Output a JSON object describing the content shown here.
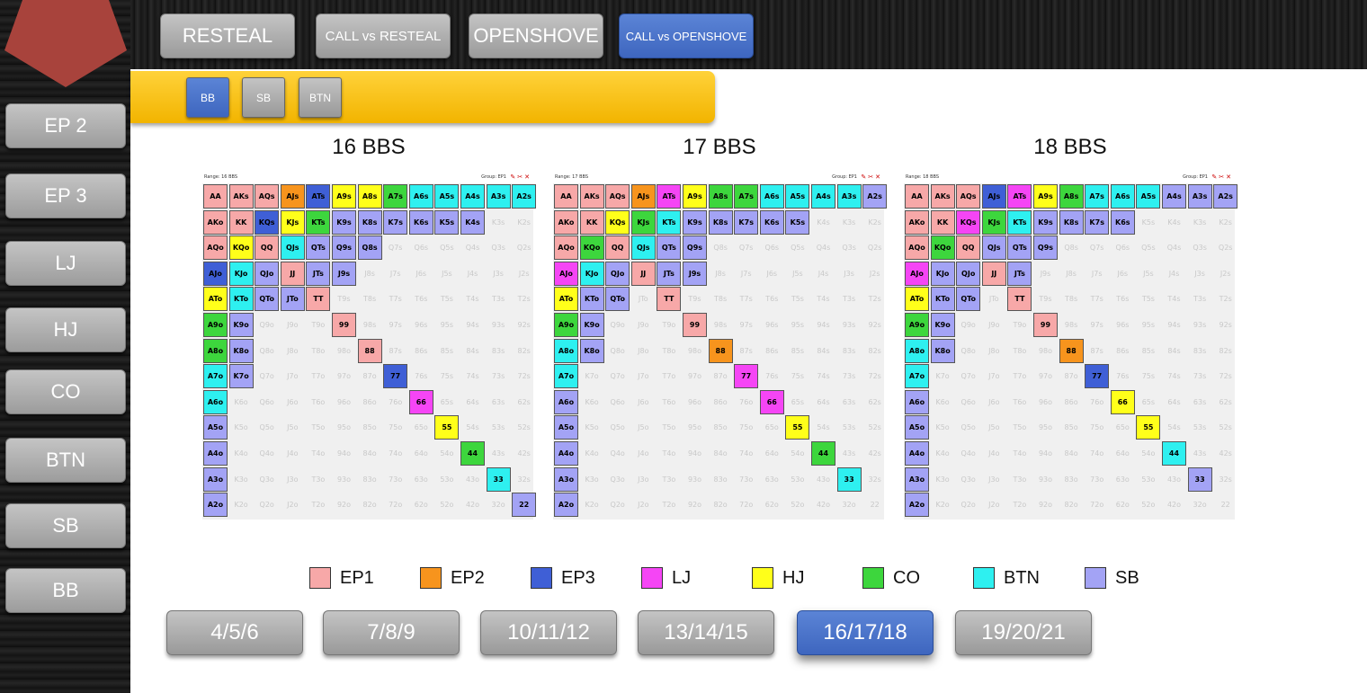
{
  "top_tabs": [
    {
      "label": "RESTEAL",
      "active": false
    },
    {
      "label": "CALL vs RESTEAL",
      "active": false
    },
    {
      "label": "OPENSHOVE",
      "active": false
    },
    {
      "label": "CALL vs OPENSHOVE",
      "active": true
    }
  ],
  "sidebar": {
    "items": [
      {
        "label": "EP 2"
      },
      {
        "label": "EP 3"
      },
      {
        "label": "LJ"
      },
      {
        "label": "HJ"
      },
      {
        "label": "CO"
      },
      {
        "label": "BTN"
      },
      {
        "label": "SB"
      },
      {
        "label": "BB"
      }
    ]
  },
  "position_tabs": [
    {
      "label": "BB",
      "active": true
    },
    {
      "label": "SB",
      "active": false
    },
    {
      "label": "BTN",
      "active": false
    }
  ],
  "colors": {
    "EP1": "#f7a8a8",
    "EP2": "#f7941d",
    "EP3": "#3f5fd6",
    "LJ": "#f545f5",
    "HJ": "#ffff1a",
    "CO": "#3dd63d",
    "BTN": "#2ef0f0",
    "SB": "#a3a3f5"
  },
  "legend": [
    {
      "key": "EP1",
      "label": "EP1"
    },
    {
      "key": "EP2",
      "label": "EP2"
    },
    {
      "key": "EP3",
      "label": "EP3"
    },
    {
      "key": "LJ",
      "label": "LJ"
    },
    {
      "key": "HJ",
      "label": "HJ"
    },
    {
      "key": "CO",
      "label": "CO"
    },
    {
      "key": "BTN",
      "label": "BTN"
    },
    {
      "key": "SB",
      "label": "SB"
    }
  ],
  "ranks": [
    "A",
    "K",
    "Q",
    "J",
    "T",
    "9",
    "8",
    "7",
    "6",
    "5",
    "4",
    "3",
    "2"
  ],
  "charts": [
    {
      "title": "16 BBS",
      "range_label": "Range: 16 BBS",
      "group_label": "Group: EP1",
      "cells": {
        "AA": "EP1",
        "AKs": "EP1",
        "AQs": "EP1",
        "AJs": "EP2",
        "ATs": "EP3",
        "A9s": "HJ",
        "A8s": "HJ",
        "A7s": "CO",
        "A6s": "BTN",
        "A5s": "BTN",
        "A4s": "BTN",
        "A3s": "BTN",
        "A2s": "BTN",
        "AKo": "EP1",
        "KK": "EP1",
        "KQs": "EP3",
        "KJs": "HJ",
        "KTs": "CO",
        "K9s": "SB",
        "K8s": "SB",
        "K7s": "SB",
        "K6s": "SB",
        "K5s": "SB",
        "K4s": "SB",
        "AQo": "EP1",
        "KQo": "HJ",
        "QQ": "EP1",
        "QJs": "BTN",
        "QTs": "SB",
        "Q9s": "SB",
        "Q8s": "SB",
        "AJo": "EP3",
        "KJo": "BTN",
        "QJo": "SB",
        "JJ": "EP1",
        "JTs": "SB",
        "J9s": "SB",
        "ATo": "HJ",
        "KTo": "BTN",
        "QTo": "SB",
        "JTo": "SB",
        "TT": "EP1",
        "A9o": "CO",
        "K9o": "SB",
        "99": "EP1",
        "A8o": "CO",
        "K8o": "SB",
        "88": "EP1",
        "A7o": "BTN",
        "K7o": "SB",
        "77": "EP3",
        "A6o": "BTN",
        "66": "LJ",
        "A5o": "SB",
        "55": "HJ",
        "A4o": "SB",
        "44": "CO",
        "A3o": "SB",
        "33": "BTN",
        "A2o": "SB",
        "22": "SB"
      }
    },
    {
      "title": "17 BBS",
      "range_label": "Range: 17 BBS",
      "group_label": "Group: EP1",
      "cells": {
        "AA": "EP1",
        "AKs": "EP1",
        "AQs": "EP1",
        "AJs": "EP2",
        "ATs": "LJ",
        "A9s": "HJ",
        "A8s": "CO",
        "A7s": "CO",
        "A6s": "BTN",
        "A5s": "BTN",
        "A4s": "BTN",
        "A3s": "BTN",
        "A2s": "SB",
        "AKo": "EP1",
        "KK": "EP1",
        "KQs": "HJ",
        "KJs": "CO",
        "KTs": "BTN",
        "K9s": "SB",
        "K8s": "SB",
        "K7s": "SB",
        "K6s": "SB",
        "K5s": "SB",
        "AQo": "EP1",
        "KQo": "CO",
        "QQ": "EP1",
        "QJs": "BTN",
        "QTs": "SB",
        "Q9s": "SB",
        "AJo": "LJ",
        "KJo": "BTN",
        "QJo": "SB",
        "JJ": "EP1",
        "JTs": "SB",
        "J9s": "SB",
        "ATo": "HJ",
        "KTo": "SB",
        "QTo": "SB",
        "TT": "EP1",
        "A9o": "CO",
        "K9o": "SB",
        "99": "EP1",
        "A8o": "BTN",
        "K8o": "SB",
        "88": "EP2",
        "A7o": "BTN",
        "77": "LJ",
        "A6o": "SB",
        "66": "LJ",
        "A5o": "SB",
        "55": "HJ",
        "A4o": "SB",
        "44": "CO",
        "A3o": "SB",
        "33": "BTN",
        "A2o": "SB"
      }
    },
    {
      "title": "18 BBS",
      "range_label": "Range: 18 BBS",
      "group_label": "Group: EP1",
      "cells": {
        "AA": "EP1",
        "AKs": "EP1",
        "AQs": "EP1",
        "AJs": "EP3",
        "ATs": "LJ",
        "A9s": "HJ",
        "A8s": "CO",
        "A7s": "BTN",
        "A6s": "BTN",
        "A5s": "BTN",
        "A4s": "SB",
        "A3s": "SB",
        "A2s": "SB",
        "AKo": "EP1",
        "KK": "EP1",
        "KQs": "LJ",
        "KJs": "CO",
        "KTs": "BTN",
        "K9s": "SB",
        "K8s": "SB",
        "K7s": "SB",
        "K6s": "SB",
        "AQo": "EP1",
        "KQo": "CO",
        "QQ": "EP1",
        "QJs": "SB",
        "QTs": "SB",
        "Q9s": "SB",
        "AJo": "LJ",
        "KJo": "SB",
        "QJo": "SB",
        "JJ": "EP1",
        "JTs": "SB",
        "ATo": "HJ",
        "KTo": "SB",
        "QTo": "SB",
        "TT": "EP1",
        "A9o": "CO",
        "K9o": "SB",
        "99": "EP1",
        "A8o": "BTN",
        "K8o": "SB",
        "88": "EP2",
        "A7o": "BTN",
        "77": "EP3",
        "A6o": "SB",
        "66": "HJ",
        "A5o": "SB",
        "55": "HJ",
        "A4o": "SB",
        "44": "BTN",
        "A3o": "SB",
        "33": "SB",
        "A2o": "SB"
      }
    }
  ],
  "stack_buttons": [
    {
      "label": "4/5/6",
      "active": false
    },
    {
      "label": "7/8/9",
      "active": false
    },
    {
      "label": "10/11/12",
      "active": false
    },
    {
      "label": "13/14/15",
      "active": false
    },
    {
      "label": "16/17/18",
      "active": true
    },
    {
      "label": "19/20/21",
      "active": false
    }
  ]
}
